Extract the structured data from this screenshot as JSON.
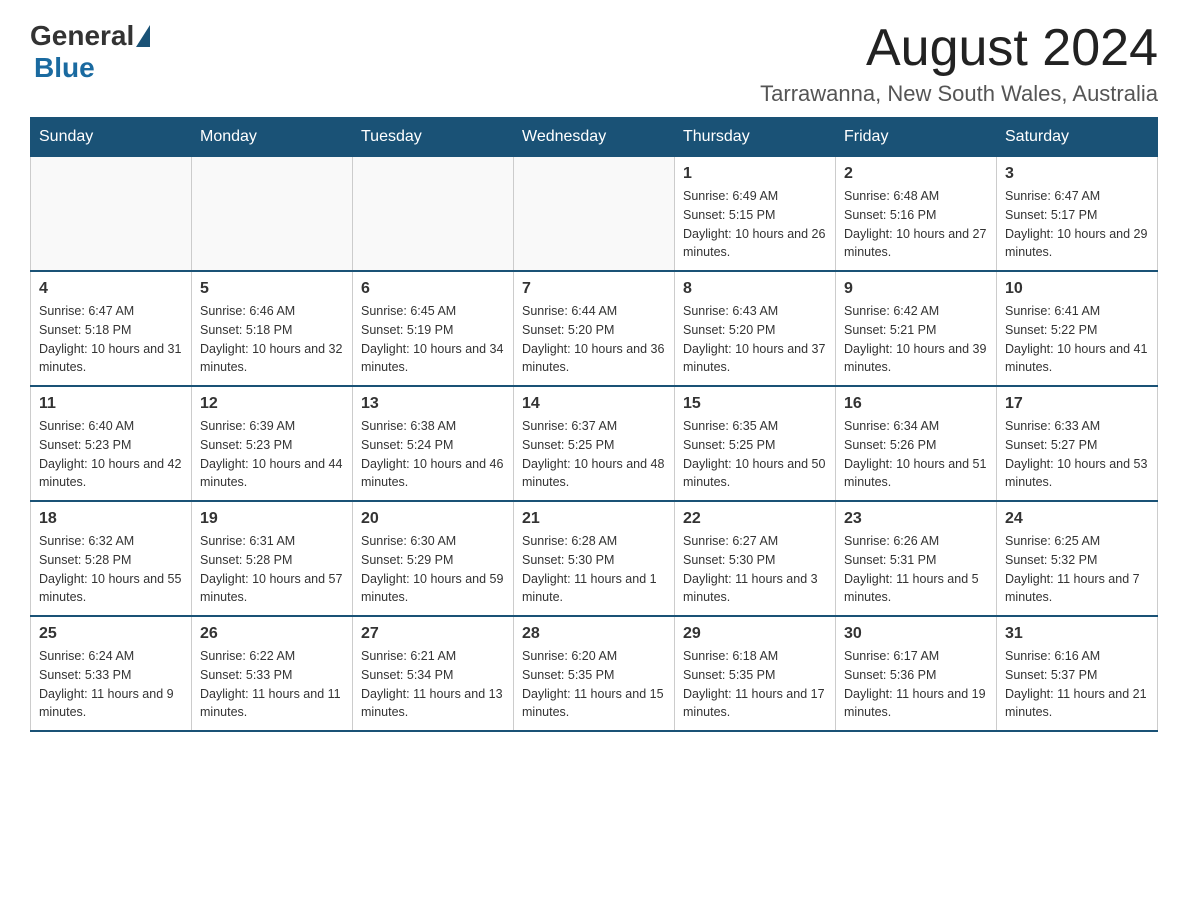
{
  "header": {
    "logo_general": "General",
    "logo_blue": "Blue",
    "month_title": "August 2024",
    "location": "Tarrawanna, New South Wales, Australia"
  },
  "days_of_week": [
    "Sunday",
    "Monday",
    "Tuesday",
    "Wednesday",
    "Thursday",
    "Friday",
    "Saturday"
  ],
  "weeks": [
    [
      {
        "day": "",
        "info": ""
      },
      {
        "day": "",
        "info": ""
      },
      {
        "day": "",
        "info": ""
      },
      {
        "day": "",
        "info": ""
      },
      {
        "day": "1",
        "info": "Sunrise: 6:49 AM\nSunset: 5:15 PM\nDaylight: 10 hours and 26 minutes."
      },
      {
        "day": "2",
        "info": "Sunrise: 6:48 AM\nSunset: 5:16 PM\nDaylight: 10 hours and 27 minutes."
      },
      {
        "day": "3",
        "info": "Sunrise: 6:47 AM\nSunset: 5:17 PM\nDaylight: 10 hours and 29 minutes."
      }
    ],
    [
      {
        "day": "4",
        "info": "Sunrise: 6:47 AM\nSunset: 5:18 PM\nDaylight: 10 hours and 31 minutes."
      },
      {
        "day": "5",
        "info": "Sunrise: 6:46 AM\nSunset: 5:18 PM\nDaylight: 10 hours and 32 minutes."
      },
      {
        "day": "6",
        "info": "Sunrise: 6:45 AM\nSunset: 5:19 PM\nDaylight: 10 hours and 34 minutes."
      },
      {
        "day": "7",
        "info": "Sunrise: 6:44 AM\nSunset: 5:20 PM\nDaylight: 10 hours and 36 minutes."
      },
      {
        "day": "8",
        "info": "Sunrise: 6:43 AM\nSunset: 5:20 PM\nDaylight: 10 hours and 37 minutes."
      },
      {
        "day": "9",
        "info": "Sunrise: 6:42 AM\nSunset: 5:21 PM\nDaylight: 10 hours and 39 minutes."
      },
      {
        "day": "10",
        "info": "Sunrise: 6:41 AM\nSunset: 5:22 PM\nDaylight: 10 hours and 41 minutes."
      }
    ],
    [
      {
        "day": "11",
        "info": "Sunrise: 6:40 AM\nSunset: 5:23 PM\nDaylight: 10 hours and 42 minutes."
      },
      {
        "day": "12",
        "info": "Sunrise: 6:39 AM\nSunset: 5:23 PM\nDaylight: 10 hours and 44 minutes."
      },
      {
        "day": "13",
        "info": "Sunrise: 6:38 AM\nSunset: 5:24 PM\nDaylight: 10 hours and 46 minutes."
      },
      {
        "day": "14",
        "info": "Sunrise: 6:37 AM\nSunset: 5:25 PM\nDaylight: 10 hours and 48 minutes."
      },
      {
        "day": "15",
        "info": "Sunrise: 6:35 AM\nSunset: 5:25 PM\nDaylight: 10 hours and 50 minutes."
      },
      {
        "day": "16",
        "info": "Sunrise: 6:34 AM\nSunset: 5:26 PM\nDaylight: 10 hours and 51 minutes."
      },
      {
        "day": "17",
        "info": "Sunrise: 6:33 AM\nSunset: 5:27 PM\nDaylight: 10 hours and 53 minutes."
      }
    ],
    [
      {
        "day": "18",
        "info": "Sunrise: 6:32 AM\nSunset: 5:28 PM\nDaylight: 10 hours and 55 minutes."
      },
      {
        "day": "19",
        "info": "Sunrise: 6:31 AM\nSunset: 5:28 PM\nDaylight: 10 hours and 57 minutes."
      },
      {
        "day": "20",
        "info": "Sunrise: 6:30 AM\nSunset: 5:29 PM\nDaylight: 10 hours and 59 minutes."
      },
      {
        "day": "21",
        "info": "Sunrise: 6:28 AM\nSunset: 5:30 PM\nDaylight: 11 hours and 1 minute."
      },
      {
        "day": "22",
        "info": "Sunrise: 6:27 AM\nSunset: 5:30 PM\nDaylight: 11 hours and 3 minutes."
      },
      {
        "day": "23",
        "info": "Sunrise: 6:26 AM\nSunset: 5:31 PM\nDaylight: 11 hours and 5 minutes."
      },
      {
        "day": "24",
        "info": "Sunrise: 6:25 AM\nSunset: 5:32 PM\nDaylight: 11 hours and 7 minutes."
      }
    ],
    [
      {
        "day": "25",
        "info": "Sunrise: 6:24 AM\nSunset: 5:33 PM\nDaylight: 11 hours and 9 minutes."
      },
      {
        "day": "26",
        "info": "Sunrise: 6:22 AM\nSunset: 5:33 PM\nDaylight: 11 hours and 11 minutes."
      },
      {
        "day": "27",
        "info": "Sunrise: 6:21 AM\nSunset: 5:34 PM\nDaylight: 11 hours and 13 minutes."
      },
      {
        "day": "28",
        "info": "Sunrise: 6:20 AM\nSunset: 5:35 PM\nDaylight: 11 hours and 15 minutes."
      },
      {
        "day": "29",
        "info": "Sunrise: 6:18 AM\nSunset: 5:35 PM\nDaylight: 11 hours and 17 minutes."
      },
      {
        "day": "30",
        "info": "Sunrise: 6:17 AM\nSunset: 5:36 PM\nDaylight: 11 hours and 19 minutes."
      },
      {
        "day": "31",
        "info": "Sunrise: 6:16 AM\nSunset: 5:37 PM\nDaylight: 11 hours and 21 minutes."
      }
    ]
  ]
}
